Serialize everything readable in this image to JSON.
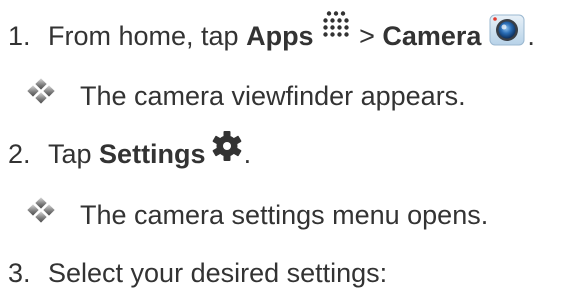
{
  "steps": [
    {
      "number": "1.",
      "pre": "From home, tap ",
      "bold1": "Apps",
      "icon1": "apps-grid-icon",
      "middle": " > ",
      "bold2": "Camera",
      "icon2": "camera-app-icon",
      "post": "."
    },
    {
      "number": "2.",
      "pre": "Tap ",
      "bold1": "Settings",
      "icon1": "gear-icon",
      "post": "."
    },
    {
      "number": "3.",
      "text": "Select your desired settings:"
    }
  ],
  "results": [
    {
      "icon": "diamond-bullet-icon",
      "text": "The camera viewfinder appears."
    },
    {
      "icon": "diamond-bullet-icon",
      "text": "The camera settings menu opens."
    }
  ],
  "colors": {
    "text": "#333333",
    "camera_bg": "#cfe3f2",
    "camera_lens": "#1d4f8c",
    "gear": "#333333"
  }
}
